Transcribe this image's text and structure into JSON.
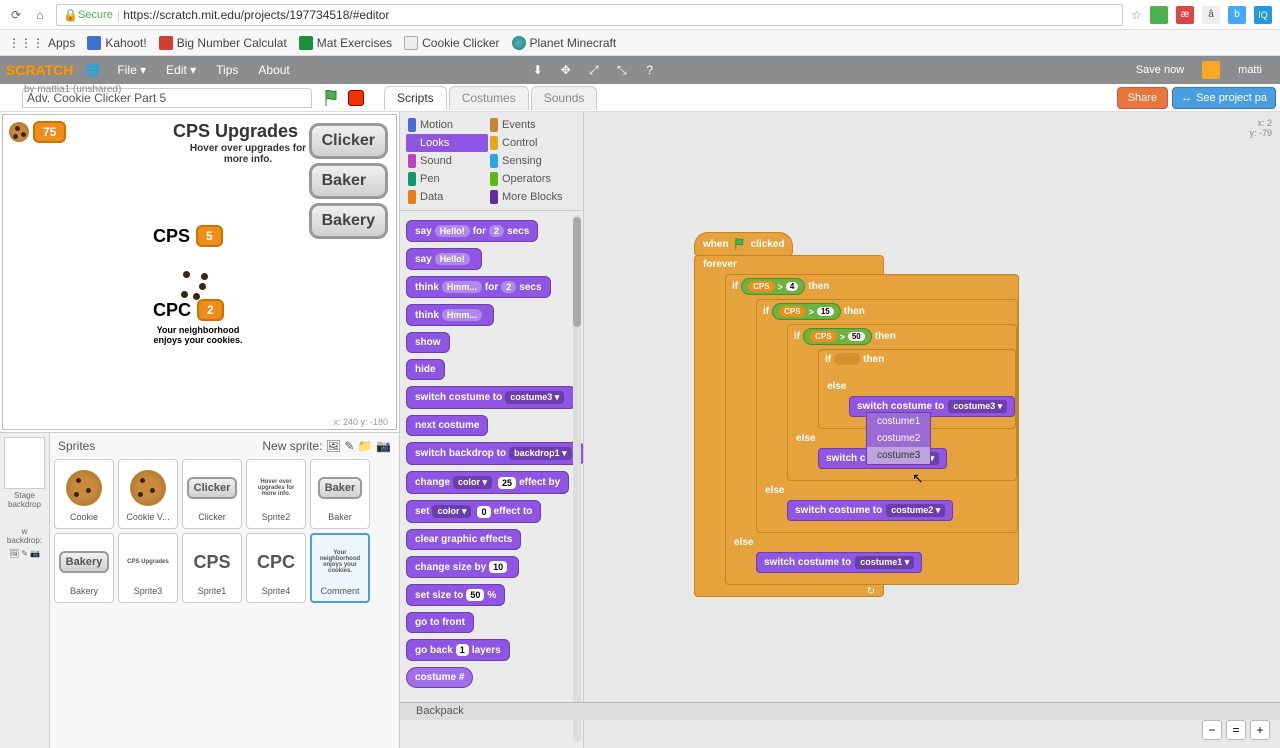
{
  "browser": {
    "url_secure": "Secure",
    "url": "https://scratch.mit.edu/projects/197734518/#editor",
    "bookmarks_label": "Apps",
    "bookmarks": [
      "Kahoot!",
      "Big Number Calculat",
      "Mat Exercises",
      "Cookie Clicker",
      "Planet Minecraft"
    ]
  },
  "menubar": {
    "logo": "SCRATCH",
    "items": [
      "File ▾",
      "Edit ▾",
      "Tips",
      "About"
    ],
    "save_now": "Save now",
    "username": "matti"
  },
  "project": {
    "title": "Adv. Cookie Clicker Part 5",
    "byline": "by mattia1 (unshared)",
    "share": "Share",
    "see_page": "See project pa"
  },
  "tabs": {
    "scripts": "Scripts",
    "costumes": "Costumes",
    "sounds": "Sounds"
  },
  "stage": {
    "score": "75",
    "title": "CPS Upgrades",
    "sub": "Hover over upgrades for more info.",
    "buttons": [
      "Clicker",
      "Baker",
      "Bakery"
    ],
    "cps_label": "CPS",
    "cps_val": "5",
    "cpc_label": "CPC",
    "cpc_val": "2",
    "neighbor": "Your neighborhood enjoys your cookies.",
    "coords": "x: 240   y: -180"
  },
  "sprites": {
    "header": "Sprites",
    "new_sprite": "New sprite:",
    "stage_label": "Stage",
    "backdrop_label": "backdrop",
    "new_backdrop": "w backdrop:",
    "list": [
      {
        "label": "Cookie",
        "thumb": "cookie"
      },
      {
        "label": "Cookie V...",
        "thumb": "cookie"
      },
      {
        "label": "Clicker",
        "thumb": "Clicker",
        "btn": true
      },
      {
        "label": "Sprite2",
        "thumb": "hover",
        "tiny": true
      },
      {
        "label": "Baker",
        "thumb": "Baker",
        "btn": true
      },
      {
        "label": "Bakery",
        "thumb": "Bakery",
        "btn": true
      },
      {
        "label": "Sprite3",
        "thumb": "CPS Upgrades",
        "tiny": true
      },
      {
        "label": "Sprite1",
        "thumb": "CPS",
        "big": true
      },
      {
        "label": "Sprite4",
        "thumb": "CPC",
        "big": true
      },
      {
        "label": "Comment",
        "thumb": "neighbor",
        "tiny": true,
        "selected": true
      }
    ]
  },
  "categories": [
    {
      "name": "Motion",
      "color": "#4a6cd4"
    },
    {
      "name": "Events",
      "color": "#c88330"
    },
    {
      "name": "Looks",
      "color": "#8f56e3",
      "selected": true
    },
    {
      "name": "Control",
      "color": "#e1a91a"
    },
    {
      "name": "Sound",
      "color": "#bb42c3"
    },
    {
      "name": "Sensing",
      "color": "#2ca5e2"
    },
    {
      "name": "Pen",
      "color": "#0e9a6c"
    },
    {
      "name": "Operators",
      "color": "#5cb712"
    },
    {
      "name": "Data",
      "color": "#ee7d16"
    },
    {
      "name": "More Blocks",
      "color": "#632d99"
    }
  ],
  "palette_blocks": [
    {
      "t": "say",
      "args": [
        "Hello!",
        "for",
        "2",
        "secs"
      ]
    },
    {
      "t": "say",
      "args": [
        "Hello!"
      ]
    },
    {
      "t": "think",
      "args": [
        "Hmm...",
        "for",
        "2",
        "secs"
      ]
    },
    {
      "t": "think",
      "args": [
        "Hmm..."
      ]
    },
    {
      "t": "show"
    },
    {
      "t": "hide"
    },
    {
      "t": "switch costume to",
      "drop": "costume3"
    },
    {
      "t": "next costume"
    },
    {
      "t": "switch backdrop to",
      "drop": "backdrop1"
    },
    {
      "t": "change",
      "drop": "color",
      "t2": "effect by",
      "num": "25"
    },
    {
      "t": "set",
      "drop": "color",
      "t2": "effect to",
      "num": "0"
    },
    {
      "t": "clear graphic effects"
    },
    {
      "t": "change size by",
      "num": "10"
    },
    {
      "t": "set size to",
      "num": "50",
      "t2": "%"
    },
    {
      "t": "go to front"
    },
    {
      "t": "go back",
      "num": "1",
      "t2": "layers"
    },
    {
      "t": "costume #",
      "reporter": true
    }
  ],
  "script": {
    "hat": "when",
    "hat2": "clicked",
    "forever": "forever",
    "if": "if",
    "then": "then",
    "else": "else",
    "var": "CPS",
    "gt": ">",
    "vals": [
      "4",
      "15",
      "50"
    ],
    "switch": "switch costume to",
    "costumes": [
      "costume3",
      "costume2",
      "costume1"
    ],
    "dropdown": [
      "costume1",
      "costume2",
      "costume3"
    ]
  },
  "readout": {
    "line1": "",
    "x": "x: 2",
    "y": "y: -79"
  },
  "backpack": "Backpack"
}
